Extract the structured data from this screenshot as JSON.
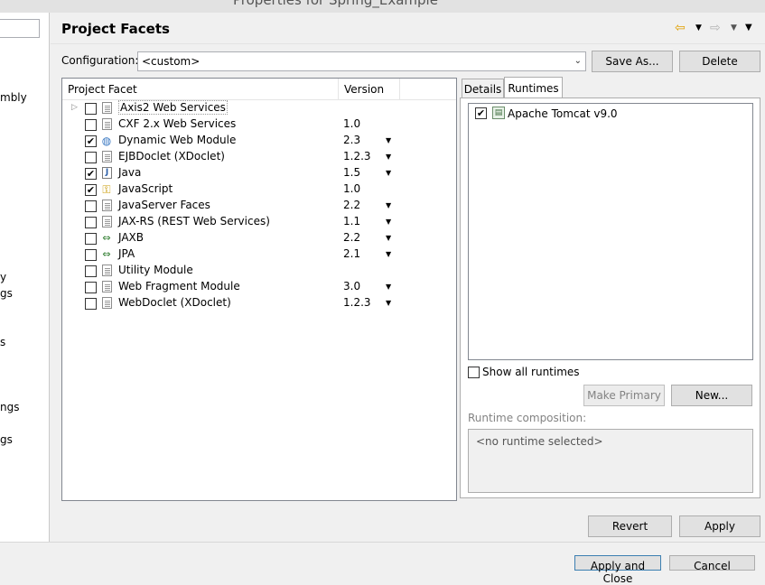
{
  "window": {
    "title": "Properties for Spring_Example"
  },
  "left_tree": {
    "fragments": [
      "mbly",
      "y",
      "gs",
      "s",
      "ngs",
      "gs"
    ]
  },
  "page": {
    "title": "Project Facets",
    "nav_icons": [
      "back-arrow-icon",
      "back-menu-icon",
      "forward-arrow-icon",
      "forward-menu-icon",
      "view-menu-icon"
    ]
  },
  "configuration": {
    "label": "Configuration:",
    "value": "<custom>",
    "save_as_label": "Save As...",
    "delete_label": "Delete"
  },
  "facets_table": {
    "columns": [
      "Project Facet",
      "Version"
    ],
    "rows": [
      {
        "name": "Axis2 Web Services",
        "version": "",
        "checked": false,
        "has_dropdown": false,
        "expandable": true,
        "icon": "document-icon"
      },
      {
        "name": "CXF 2.x Web Services",
        "version": "1.0",
        "checked": false,
        "has_dropdown": false,
        "icon": "document-icon"
      },
      {
        "name": "Dynamic Web Module",
        "version": "2.3",
        "checked": true,
        "has_dropdown": true,
        "icon": "globe-icon"
      },
      {
        "name": "EJBDoclet (XDoclet)",
        "version": "1.2.3",
        "checked": false,
        "has_dropdown": true,
        "icon": "document-icon"
      },
      {
        "name": "Java",
        "version": "1.5",
        "checked": true,
        "has_dropdown": true,
        "icon": "java-icon"
      },
      {
        "name": "JavaScript",
        "version": "1.0",
        "checked": true,
        "has_dropdown": false,
        "icon": "javascript-icon"
      },
      {
        "name": "JavaServer Faces",
        "version": "2.2",
        "checked": false,
        "has_dropdown": true,
        "icon": "document-icon"
      },
      {
        "name": "JAX-RS (REST Web Services)",
        "version": "1.1",
        "checked": false,
        "has_dropdown": true,
        "icon": "document-icon"
      },
      {
        "name": "JAXB",
        "version": "2.2",
        "checked": false,
        "has_dropdown": true,
        "icon": "jaxb-icon"
      },
      {
        "name": "JPA",
        "version": "2.1",
        "checked": false,
        "has_dropdown": true,
        "icon": "jpa-icon"
      },
      {
        "name": "Utility Module",
        "version": "",
        "checked": false,
        "has_dropdown": false,
        "icon": "document-icon"
      },
      {
        "name": "Web Fragment Module",
        "version": "3.0",
        "checked": false,
        "has_dropdown": true,
        "icon": "document-icon"
      },
      {
        "name": "WebDoclet (XDoclet)",
        "version": "1.2.3",
        "checked": false,
        "has_dropdown": true,
        "icon": "document-icon"
      }
    ]
  },
  "tabs": {
    "details_label": "Details",
    "runtimes_label": "Runtimes",
    "active": "Runtimes"
  },
  "runtimes": {
    "items": [
      {
        "name": "Apache Tomcat v9.0",
        "checked": true,
        "icon": "server-icon"
      }
    ],
    "show_all_label": "Show all runtimes",
    "show_all_checked": false,
    "make_primary_label": "Make Primary",
    "new_label": "New...",
    "composition_label": "Runtime composition:",
    "composition_value": "<no runtime selected>"
  },
  "buttons": {
    "revert_label": "Revert",
    "apply_label": "Apply",
    "apply_close_label": "Apply and Close",
    "cancel_label": "Cancel"
  }
}
